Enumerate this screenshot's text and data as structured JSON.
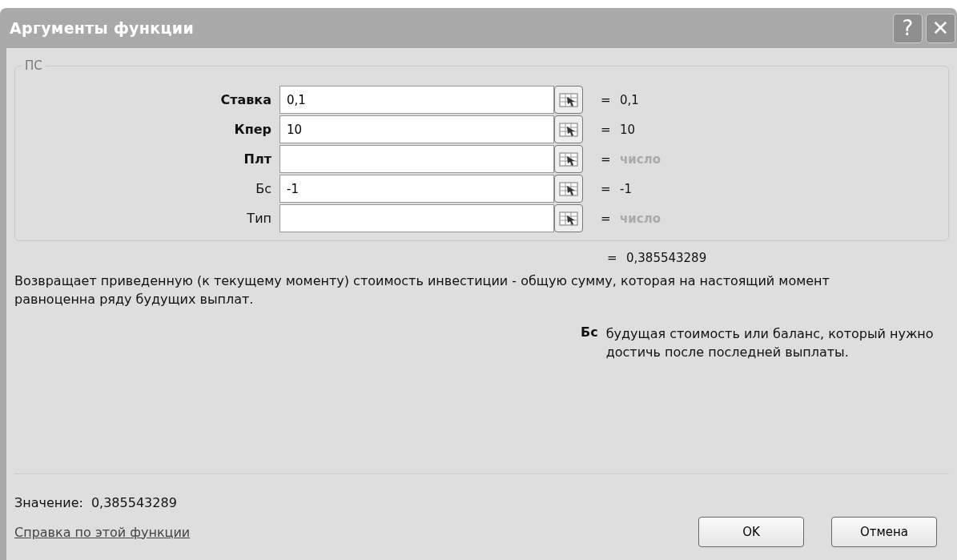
{
  "window": {
    "title": "Аргументы функции",
    "buttons": [
      "?",
      "✕"
    ]
  },
  "group": {
    "title": "ПС",
    "arguments": [
      {
        "label": "Ставка",
        "required": true,
        "value": "0,1",
        "result": "0,1",
        "muted": false
      },
      {
        "label": "Кпер",
        "required": true,
        "value": "10",
        "result": "10",
        "muted": false
      },
      {
        "label": "Плт",
        "required": true,
        "result": "число",
        "muted": true
      },
      {
        "label": "Бс",
        "required": false,
        "value": "-1",
        "result": "-1",
        "muted": false
      },
      {
        "label": "Тип",
        "required": false,
        "result": "число",
        "muted": true
      }
    ]
  },
  "equals": "=",
  "formula_result": "0,385543289",
  "description": "Возвращает приведенную (к текущему моменту) стоимость инвестиции - общую сумму, которая на настоящий момент равноценна ряду будущих выплат.",
  "argument_help": {
    "name": "Бс",
    "text": "будущая стоимость или баланс, который нужно достичь после последней выплаты."
  },
  "value": {
    "label": "Значение:",
    "text": "0,385543289"
  },
  "help_link": "Справка по этой функции",
  "buttons": [
    "OK",
    "Отмена"
  ]
}
